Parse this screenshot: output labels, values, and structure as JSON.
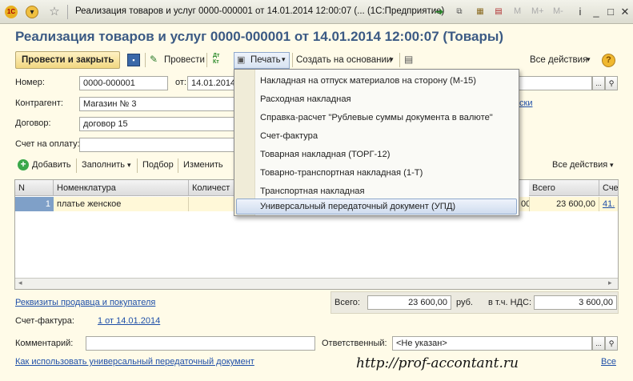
{
  "window": {
    "title": "Реализация товаров и услуг 0000-000001 от 14.01.2014 12:00:07 (... (1С:Предприятие)",
    "app_badge": "1С",
    "m_buttons": [
      "M",
      "M+",
      "M-"
    ]
  },
  "form": {
    "heading": "Реализация товаров и услуг 0000-000001 от 14.01.2014 12:00:07 (Товары)"
  },
  "toolbar": {
    "post_close": "Провести и закрыть",
    "post": "Провести",
    "dtkt": "Дт Кт",
    "print": "Печать",
    "create_based": "Создать на основании",
    "all_actions": "Все действия"
  },
  "fields": {
    "number_label": "Номер:",
    "number_value": "0000-000001",
    "date_label": "от:",
    "date_value": "14.01.2014",
    "counterparty_label": "Контрагент:",
    "counterparty_value": "Магазин № 3",
    "contract_label": "Договор:",
    "contract_value": "договор 15",
    "invoice_label": "Счет на оплату:",
    "invoice_value": "",
    "link_fragment": "ски"
  },
  "table_toolbar": {
    "add": "Добавить",
    "fill": "Заполнить",
    "select": "Подбор",
    "edit": "Изменить",
    "all_actions": "Все действия"
  },
  "table": {
    "columns": [
      "N",
      "Номенклатура",
      "Количест",
      "Всего",
      "Сче"
    ],
    "rows": [
      {
        "n": "1",
        "item": "платье женское",
        "qty": "",
        "cut": "00",
        "total": "23 600,00",
        "account": "41."
      }
    ]
  },
  "print_menu": {
    "items": [
      "Накладная на отпуск материалов на сторону (М-15)",
      "Расходная накладная",
      "Справка-расчет \"Рублевые суммы документа в валюте\"",
      "Счет-фактура",
      "Товарная накладная (ТОРГ-12)",
      "Товарно-транспортная накладная (1-Т)",
      "Транспортная накладная",
      "Универсальный передаточный документ (УПД)"
    ],
    "selected_index": 7
  },
  "totals": {
    "requisites_link": "Реквизиты продавца и покупателя",
    "total_label": "Всего:",
    "total_value": "23 600,00",
    "currency": "руб.",
    "vat_label": "в т.ч. НДС:",
    "vat_value": "3 600,00"
  },
  "invoice": {
    "label": "Счет-фактура:",
    "link": "1 от 14.01.2014"
  },
  "bottom": {
    "comment_label": "Комментарий:",
    "comment_value": "",
    "responsible_label": "Ответственный:",
    "responsible_value": "<Не указан>",
    "help_link": "Как использовать универсальный передаточный документ",
    "all_link": "Все"
  },
  "watermark": "http://prof-accontant.ru",
  "colors": {
    "heading": "#3b5a84",
    "primary_button": "#f1d780",
    "link": "#1f4fa8",
    "selection": "#cfdcef"
  }
}
